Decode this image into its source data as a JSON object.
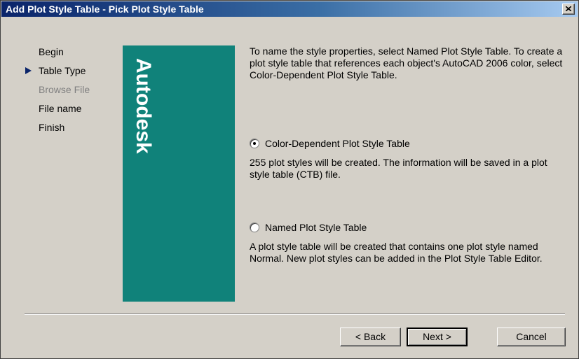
{
  "window": {
    "title": "Add Plot Style Table - Pick Plot Style Table",
    "close_icon": "close-x-icon"
  },
  "steps": [
    {
      "label": "Begin",
      "state": "normal"
    },
    {
      "label": "Table Type",
      "state": "current"
    },
    {
      "label": "Browse File",
      "state": "disabled"
    },
    {
      "label": "File name",
      "state": "normal"
    },
    {
      "label": "Finish",
      "state": "normal"
    }
  ],
  "brand": {
    "wordmark": "Autodesk",
    "color": "#10827a"
  },
  "content": {
    "intro": "To name the style properties, select Named Plot Style Table. To create a plot style table that references each object's AutoCAD 2006 color, select Color-Dependent Plot Style Table.",
    "options": [
      {
        "label": "Color-Dependent Plot Style Table",
        "selected": true,
        "description": "255 plot styles will be created. The information will be saved in a plot style table (CTB) file."
      },
      {
        "label": "Named Plot Style Table",
        "selected": false,
        "description": "A plot style table will be created that contains one plot style named Normal.  New plot styles can be added in the Plot Style Table Editor."
      }
    ]
  },
  "buttons": {
    "back": "< Back",
    "next": "Next >",
    "cancel": "Cancel"
  },
  "colors": {
    "titlebar_start": "#0a246a",
    "titlebar_end": "#a6caf0",
    "dialog_face": "#d4d0c8",
    "step_marker": "#0a246a"
  }
}
